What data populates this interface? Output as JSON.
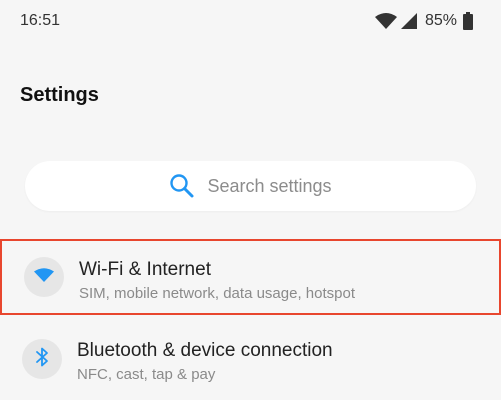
{
  "status_bar": {
    "time": "16:51",
    "battery_percent": "85%",
    "icons": [
      "wifi-icon",
      "cell-signal-icon",
      "battery-icon"
    ]
  },
  "page": {
    "title": "Settings"
  },
  "search": {
    "placeholder": "Search settings",
    "icon": "search-icon"
  },
  "settings_items": [
    {
      "title": "Wi-Fi & Internet",
      "subtitle": "SIM, mobile network, data usage, hotspot",
      "icon": "wifi-icon",
      "highlighted": true
    },
    {
      "title": "Bluetooth & device connection",
      "subtitle": "NFC, cast, tap & pay",
      "icon": "bluetooth-icon",
      "highlighted": false
    }
  ],
  "colors": {
    "accent": "#2196f3",
    "highlight_border": "#e8462e",
    "background": "#f6f6f6"
  }
}
